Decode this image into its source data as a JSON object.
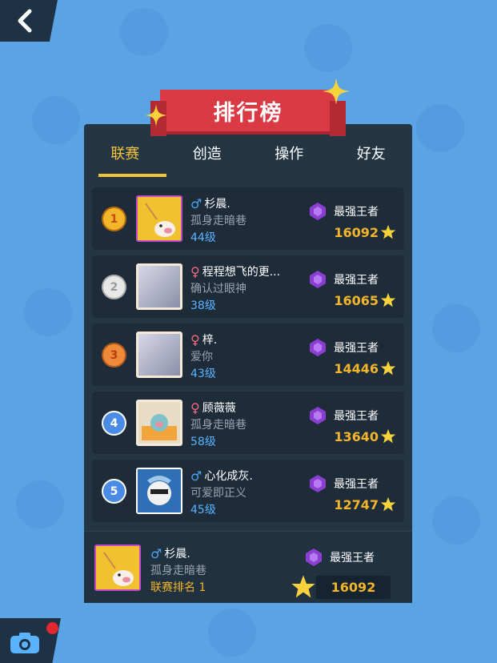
{
  "banner": {
    "title": "排行榜"
  },
  "tabs": [
    {
      "label": "联赛",
      "active": true
    },
    {
      "label": "创造",
      "active": false
    },
    {
      "label": "操作",
      "active": false
    },
    {
      "label": "好友",
      "active": false
    }
  ],
  "entries": [
    {
      "rank": "1",
      "gender": "♂",
      "gender_type": "male",
      "name": "杉晨.",
      "motto": "孤身走暗巷",
      "level": "44级",
      "tier": "最强王者",
      "score": "16092",
      "avatar": "pig"
    },
    {
      "rank": "2",
      "gender": "♀",
      "gender_type": "female",
      "name": "程程想飞的更...",
      "motto": "确认过眼神",
      "level": "38级",
      "tier": "最强王者",
      "score": "16065",
      "avatar": "anime"
    },
    {
      "rank": "3",
      "gender": "♀",
      "gender_type": "female",
      "name": "梓.",
      "motto": "爱你",
      "level": "43级",
      "tier": "最强王者",
      "score": "14446",
      "avatar": "anime"
    },
    {
      "rank": "4",
      "gender": "♀",
      "gender_type": "female",
      "name": "顾薇薇",
      "motto": "孤身走暗巷",
      "level": "58级",
      "tier": "最强王者",
      "score": "13640",
      "avatar": "pig-frame"
    },
    {
      "rank": "5",
      "gender": "♂",
      "gender_type": "male",
      "name": "心化成灰.",
      "motto": "可爱即正义",
      "level": "45级",
      "tier": "最强王者",
      "score": "12747",
      "avatar": "cartoon"
    }
  ],
  "me": {
    "gender": "♂",
    "name": "杉晨.",
    "motto": "孤身走暗巷",
    "rank_label": "联赛排名 1",
    "tier": "最强王者",
    "score": "16092"
  },
  "icons": {
    "back": "chevron-left-icon",
    "camera": "camera-icon",
    "tier": "purple-gem-icon",
    "score": "star-icon"
  },
  "colors": {
    "accent": "#f3c43b",
    "banner": "#d93a44",
    "panel": "#243544",
    "background": "#5aa3e4",
    "male": "#4aa2f0",
    "female": "#f06b7c"
  }
}
